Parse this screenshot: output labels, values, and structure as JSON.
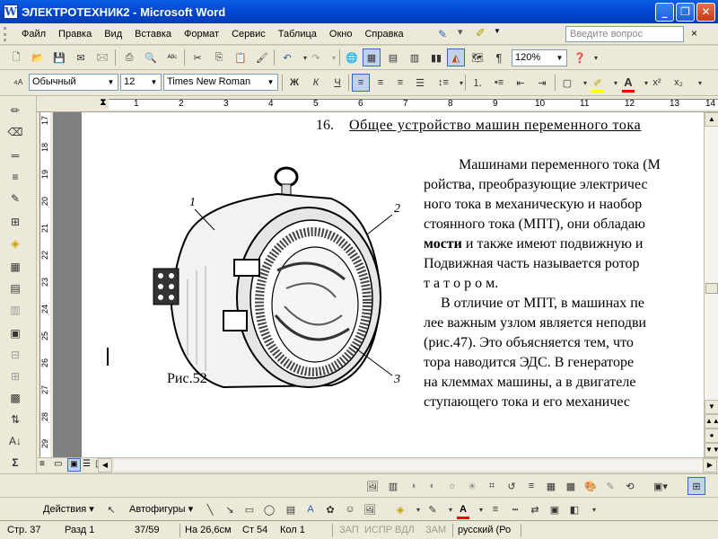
{
  "window": {
    "title": "ЭЛЕКТРОТЕХНИК2 - Microsoft Word",
    "app_icon": "W"
  },
  "menu": {
    "items": [
      "Файл",
      "Правка",
      "Вид",
      "Вставка",
      "Формат",
      "Сервис",
      "Таблица",
      "Окно",
      "Справка"
    ],
    "ask_placeholder": "Введите вопрос",
    "close": "×"
  },
  "standard_toolbar": {
    "zoom": "120%"
  },
  "formatting_toolbar": {
    "style": "Обычный",
    "size": "12",
    "font": "Times New Roman",
    "bold": "Ж",
    "italic": "К",
    "underline": "Ч",
    "superscript": "x²",
    "subscript": "x₂"
  },
  "ruler": {
    "h_numbers": [
      "1",
      "2",
      "3",
      "4",
      "5",
      "6",
      "7",
      "8",
      "9",
      "10",
      "11",
      "12",
      "13",
      "14"
    ],
    "v_numbers": [
      "17",
      "18",
      "19",
      "20",
      "21",
      "22",
      "23",
      "24",
      "25",
      "26",
      "27",
      "28",
      "29"
    ]
  },
  "document": {
    "heading_number": "16.",
    "heading_text": "Общее устройство машин переменного тока",
    "figure_caption": "Рис.52",
    "figure_labels": [
      "1",
      "2",
      "3"
    ],
    "paragraph_lines": [
      "Машинами переменного тока (М",
      "ройства, преобразующие электричес",
      "ного тока в механическую и наобор",
      "стоянного тока (МПТ), они обладаю",
      "мости и также имеют подвижную и",
      "Подвижная часть называется ротор",
      "т а т о р о м."
    ],
    "bold_word": "мости",
    "paragraph2_lines": [
      "В отличие от МПТ, в машинах пе",
      "лее важным узлом является неподви",
      "(рис.47). Это объясняется тем, что",
      "тора наводится ЭДС. В генераторе",
      "на клеммах машины, а в двигателе",
      "ступающего тока и его механичес"
    ]
  },
  "draw_toolbar": {
    "actions": "Действия",
    "autoshapes": "Автофигуры"
  },
  "status": {
    "page": "Стр. 37",
    "section": "Разд 1",
    "pages": "37/59",
    "position": "На 26,6см",
    "line": "Ст 54",
    "column": "Кол 1",
    "rec": "ЗАП",
    "trk": "ИСПР",
    "ext": "ВДЛ",
    "ovr": "ЗАМ",
    "language": "русский (Ро"
  },
  "colors": {
    "title_bar": "#0a5ee0",
    "highlight": "#ffff00",
    "font_color": "#ff0000"
  }
}
